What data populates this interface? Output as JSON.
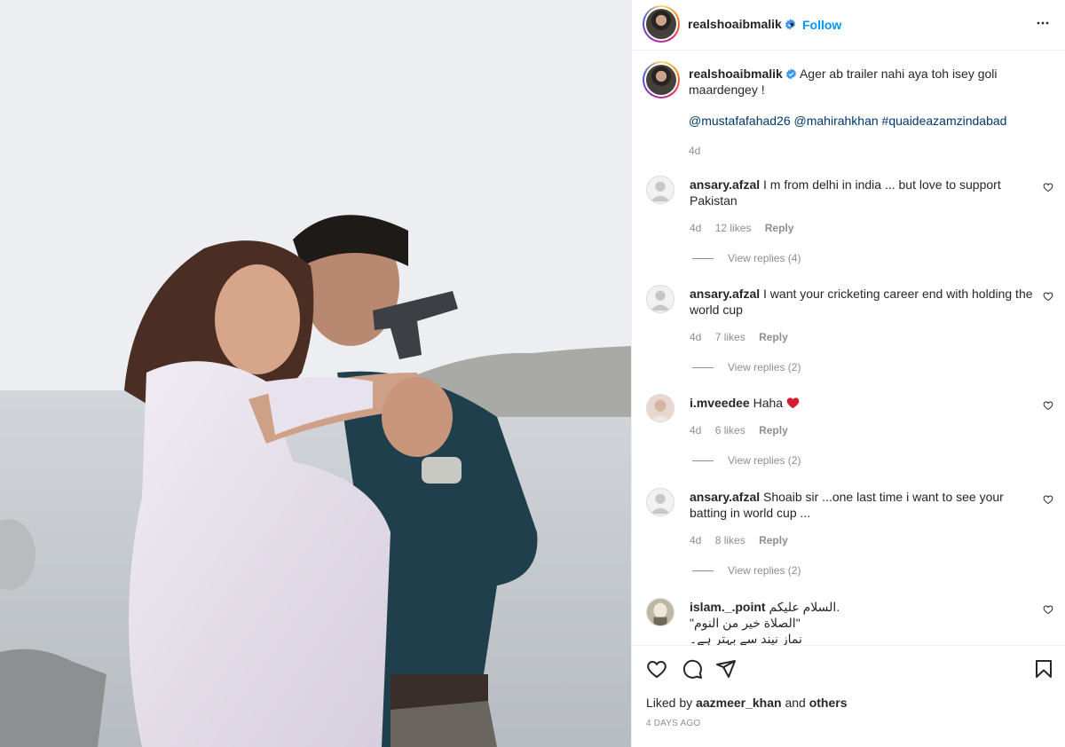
{
  "post": {
    "author": "realshoaibmalik",
    "follow_label": "Follow",
    "dot": "•",
    "caption_text": "Ager ab trailer nahi aya toh isey goli maardengey !",
    "caption_mentions": "@mustafafahad26 @mahirahkhan #quaideazamzindabad",
    "caption_time": "4d"
  },
  "comments": [
    {
      "user": "ansary.afzal",
      "text": "I m from delhi in india ... but love to support Pakistan",
      "time": "4d",
      "likes": "12 likes",
      "reply": "Reply",
      "view_replies": "View replies (4)"
    },
    {
      "user": "ansary.afzal",
      "text": "I want your cricketing career end with holding the world cup",
      "time": "4d",
      "likes": "7 likes",
      "reply": "Reply",
      "view_replies": "View replies (2)"
    },
    {
      "user": "i.mveedee",
      "text": "Haha",
      "time": "4d",
      "likes": "6 likes",
      "reply": "Reply",
      "view_replies": "View replies (2)"
    },
    {
      "user": "ansary.afzal",
      "text": "Shoaib sir ...one last time i want to see your batting in world cup ...",
      "time": "4d",
      "likes": "8 likes",
      "reply": "Reply",
      "view_replies": "View replies (2)"
    },
    {
      "user": "islam._.point",
      "text_line1": "السلام علیکم.",
      "text_line2": "\"الصلاة خير من النوم\"",
      "text_line3": "نماز نیند سے بہتر ہے۔"
    }
  ],
  "footer": {
    "liked_by_prefix": "Liked by",
    "liked_by_user": "aazmeer_khan",
    "liked_by_and": "and",
    "liked_by_others": "others",
    "post_date": "4 DAYS AGO"
  },
  "icons": {
    "heart": "heart-icon",
    "comment": "comment-icon",
    "share": "share-icon",
    "save": "bookmark-icon",
    "more": "more-options-icon",
    "verified": "verified-badge-icon"
  },
  "colors": {
    "link_blue": "#0095f6",
    "mention_blue": "#00376b",
    "muted_gray": "#8e8e8e",
    "heart_red": "#ed4956"
  }
}
